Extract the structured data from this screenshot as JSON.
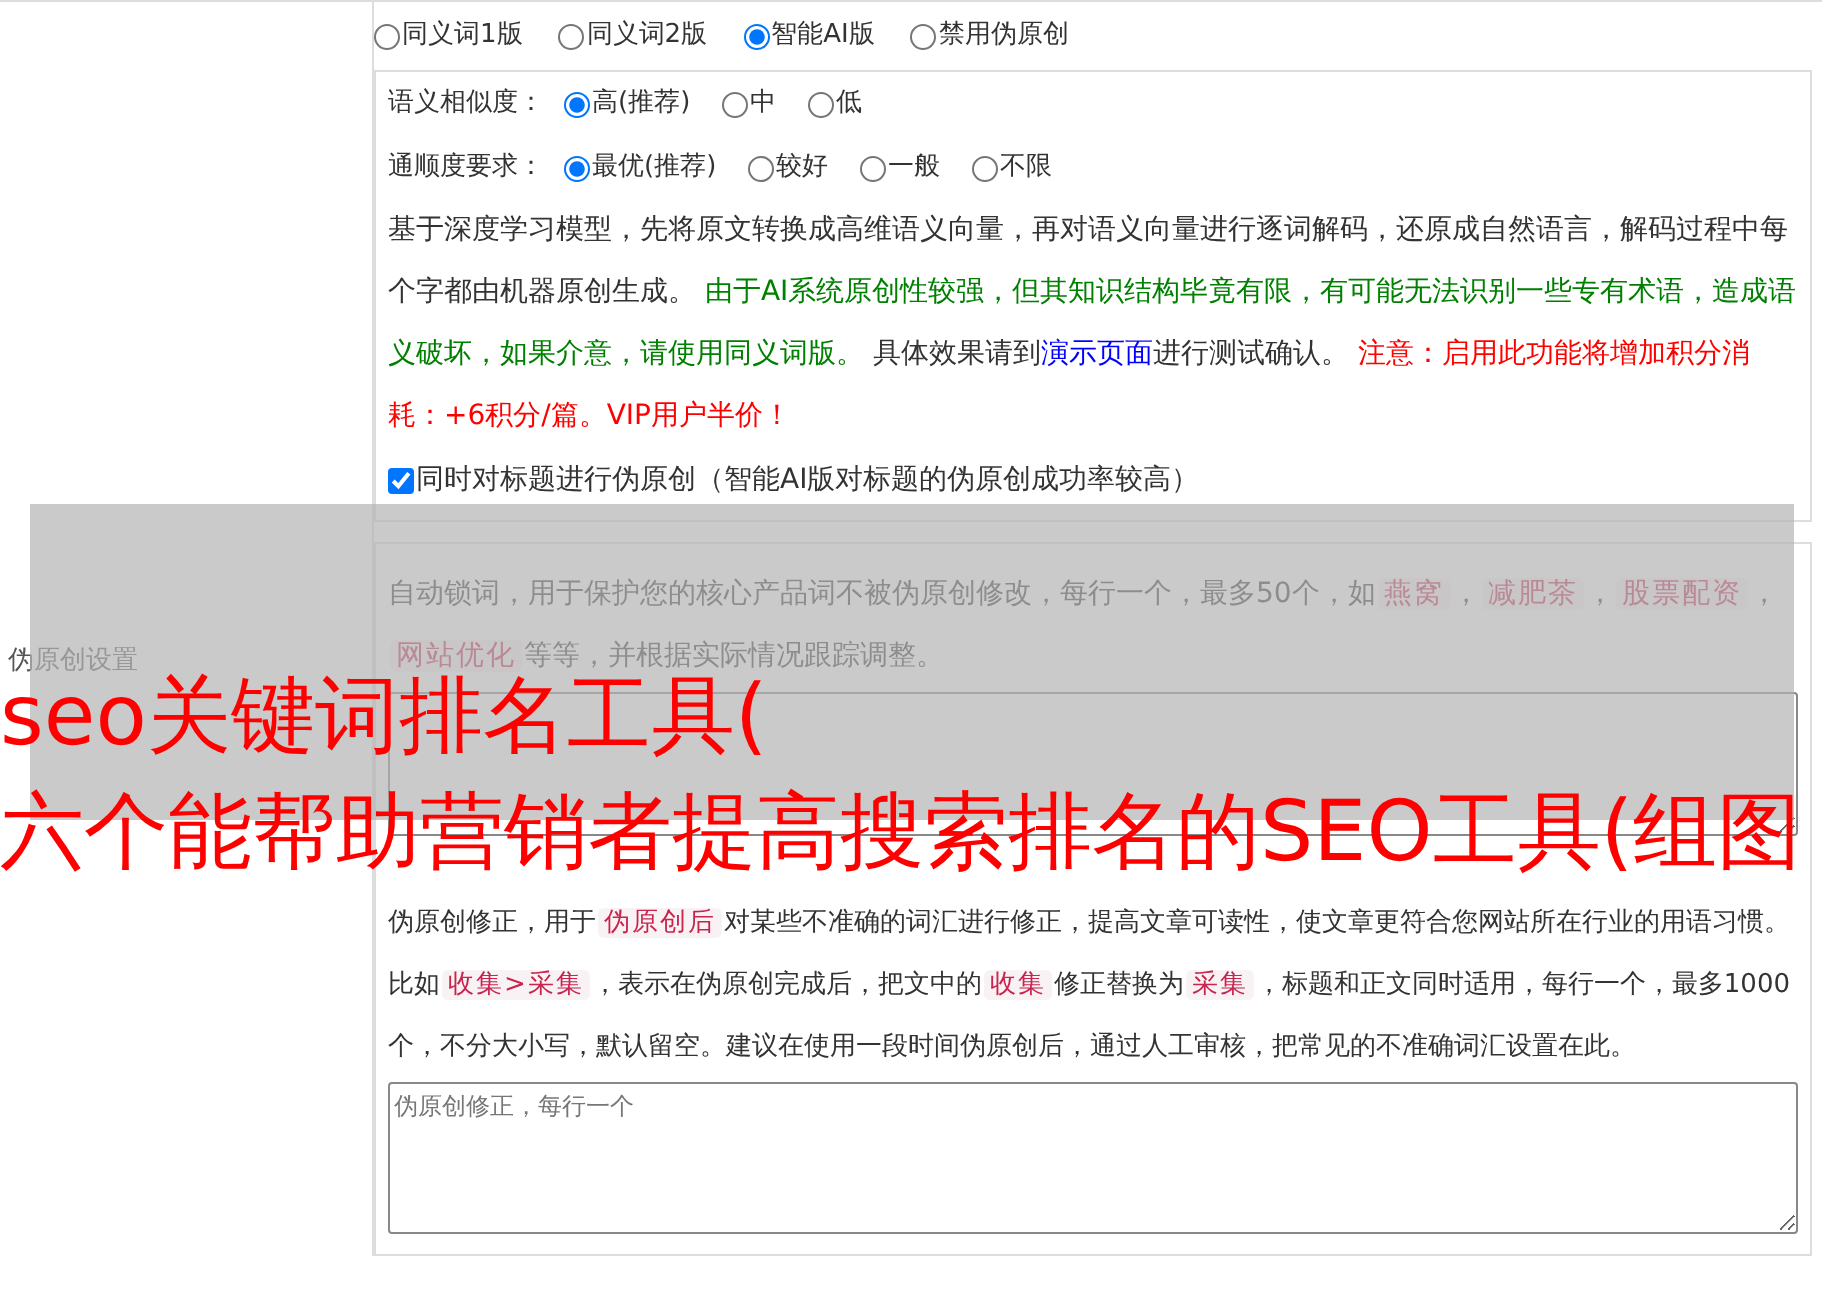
{
  "section_label": "伪原创设置",
  "modes": [
    {
      "label": "同义词1版",
      "selected": false
    },
    {
      "label": "同义词2版",
      "selected": false
    },
    {
      "label": "智能AI版",
      "selected": true
    },
    {
      "label": "禁用伪原创",
      "selected": false
    }
  ],
  "similarity": {
    "label": "语义相似度：",
    "options": [
      {
        "label": "高(推荐)",
        "selected": true
      },
      {
        "label": "中",
        "selected": false
      },
      {
        "label": "低",
        "selected": false
      }
    ]
  },
  "fluency": {
    "label": "通顺度要求：",
    "options": [
      {
        "label": "最优(推荐)",
        "selected": true
      },
      {
        "label": "较好",
        "selected": false
      },
      {
        "label": "一般",
        "selected": false
      },
      {
        "label": "不限",
        "selected": false
      }
    ]
  },
  "description": [
    {
      "kind": "plain",
      "text": "基于深度学习模型，先将原文转换成高维语义向量，再对语义向量进行逐词解码，还原成自然语言，解码过程中每个字都由机器原创生成。 "
    },
    {
      "kind": "note",
      "text": "由于AI系统原创性较强，但其知识结构毕竟有限，有可能无法识别一些专有术语，造成语义破坏，如果介意，请使用同义词版。"
    },
    {
      "kind": "plain",
      "text": " 具体效果请到"
    },
    {
      "kind": "link",
      "text": "演示页面"
    },
    {
      "kind": "plain",
      "text": "进行测试确认。 "
    },
    {
      "kind": "warning",
      "text": "注意：启用此功能将增加积分消耗：+6积分/篇。VIP用户半价！"
    }
  ],
  "title_option": {
    "label": "同时对标题进行伪原创（智能AI版对标题的伪原创成功率较高）",
    "checked": true
  },
  "lock_words": {
    "description": [
      {
        "kind": "plain",
        "text": "自动锁词，用于保护您的核心产品词不被伪原创修改，每行一个，最多50个，如"
      },
      {
        "kind": "tag",
        "text": "燕窝"
      },
      {
        "kind": "plain",
        "text": "，"
      },
      {
        "kind": "tag",
        "text": "减肥茶"
      },
      {
        "kind": "plain",
        "text": "，"
      },
      {
        "kind": "tag",
        "text": "股票配资"
      },
      {
        "kind": "plain",
        "text": "，"
      },
      {
        "kind": "tag",
        "text": "网站优化"
      },
      {
        "kind": "plain",
        "text": "等等，并根据实际情况跟踪调整。"
      }
    ]
  },
  "correction": {
    "description": [
      {
        "kind": "plain",
        "text": "伪原创修正，用于"
      },
      {
        "kind": "tag",
        "text": "伪原创后"
      },
      {
        "kind": "plain",
        "text": "对某些不准确的词汇进行修正，提高文章可读性，使文章更符合您网站所在行业的用语习惯。比如"
      },
      {
        "kind": "tag",
        "text": "收集>采集"
      },
      {
        "kind": "plain",
        "text": "，表示在伪原创完成后，把文中的"
      },
      {
        "kind": "tag",
        "text": "收集"
      },
      {
        "kind": "plain",
        "text": "修正替换为"
      },
      {
        "kind": "tag",
        "text": "采集"
      },
      {
        "kind": "plain",
        "text": "，标题和正文同时适用，每行一个，最多1000个，不分大小写，默认留空。建议在使用一段时间伪原创后，通过人工审核，把常见的不准确词汇设置在此。"
      }
    ],
    "placeholder": "伪原创修正，每行一个"
  },
  "overlay": {
    "lines": [
      "seo关键词排名工具(",
      "六个能帮助营销者提高搜索排名的SEO工具(组图"
    ]
  }
}
